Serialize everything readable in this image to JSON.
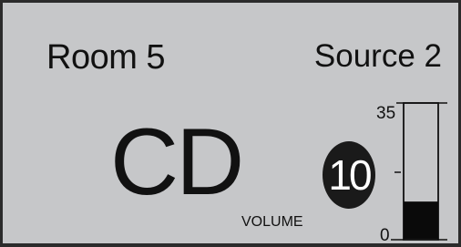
{
  "header": {
    "room_label": "Room 5",
    "source_label": "Source 2"
  },
  "main": {
    "source_name": "CD"
  },
  "volume": {
    "label": "VOLUME",
    "value": "10",
    "max_label": "35",
    "min_label": "0",
    "level_fraction": 0.2857
  },
  "colors": {
    "background": "#c6c7c9",
    "foreground": "#111111",
    "badge": "#1a1a1a",
    "badge_text": "#ffffff"
  }
}
